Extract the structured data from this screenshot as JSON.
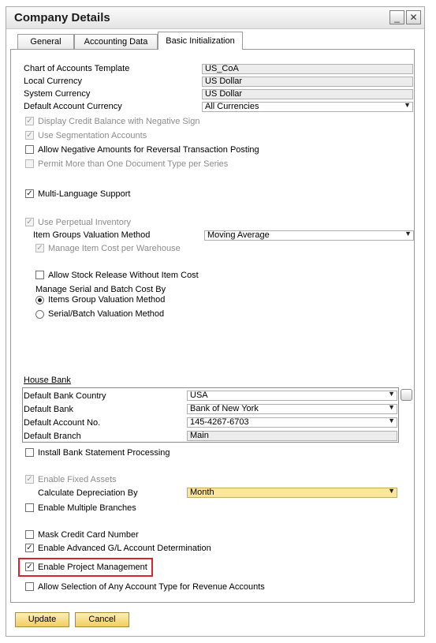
{
  "window": {
    "title": "Company Details"
  },
  "title_buttons": {
    "minimize": "_",
    "close": "✕"
  },
  "tabs": [
    {
      "label": "General"
    },
    {
      "label": "Accounting Data"
    },
    {
      "label": "Basic Initialization"
    }
  ],
  "accounts": {
    "chart_label": "Chart of Accounts Template",
    "chart_value": "US_CoA",
    "local_label": "Local Currency",
    "local_value": "US Dollar",
    "system_label": "System Currency",
    "system_value": "US Dollar",
    "default_label": "Default Account Currency",
    "default_value": "All Currencies"
  },
  "options": {
    "display_credit": "Display Credit Balance with Negative Sign",
    "use_segmentation": "Use Segmentation Accounts",
    "allow_negative": "Allow Negative Amounts for Reversal Transaction Posting",
    "permit_more": "Permit More than One Document Type per Series",
    "multi_language": "Multi-Language Support"
  },
  "inventory": {
    "use_perpetual": "Use Perpetual Inventory",
    "valuation_label": "Item Groups Valuation Method",
    "valuation_value": "Moving Average",
    "manage_cost": "Manage Item Cost per Warehouse",
    "allow_stock": "Allow Stock Release Without Item Cost",
    "serial_label": "Manage Serial and Batch Cost By",
    "radio_items_group": "Items Group Valuation Method",
    "radio_serial": "Serial/Batch Valuation Method"
  },
  "house_bank": {
    "heading": "House Bank",
    "country_label": "Default Bank Country",
    "country_value": "USA",
    "bank_label": "Default Bank",
    "bank_value": "Bank of New York",
    "account_label": "Default Account No.",
    "account_value": "145-4267-6703",
    "branch_label": "Default Branch",
    "branch_value": "Main",
    "install_statement": "Install Bank Statement Processing"
  },
  "assets": {
    "enable_fixed": "Enable Fixed Assets",
    "depreciation_label": "Calculate Depreciation By",
    "depreciation_value": "Month",
    "multiple_branches": "Enable Multiple Branches"
  },
  "misc": {
    "mask_card": "Mask Credit Card Number",
    "advanced_gl": "Enable Advanced G/L Account Determination",
    "project_mgmt": "Enable Project Management",
    "allow_selection": "Allow Selection of Any Account Type for Revenue Accounts"
  },
  "buttons": {
    "update": "Update",
    "cancel": "Cancel"
  },
  "glyphs": {
    "check": "✓",
    "dropdown": "▼"
  },
  "colors": {
    "highlight": "#d9232e",
    "button": "#f2cd62",
    "field_yellow": "#fbe69a"
  }
}
